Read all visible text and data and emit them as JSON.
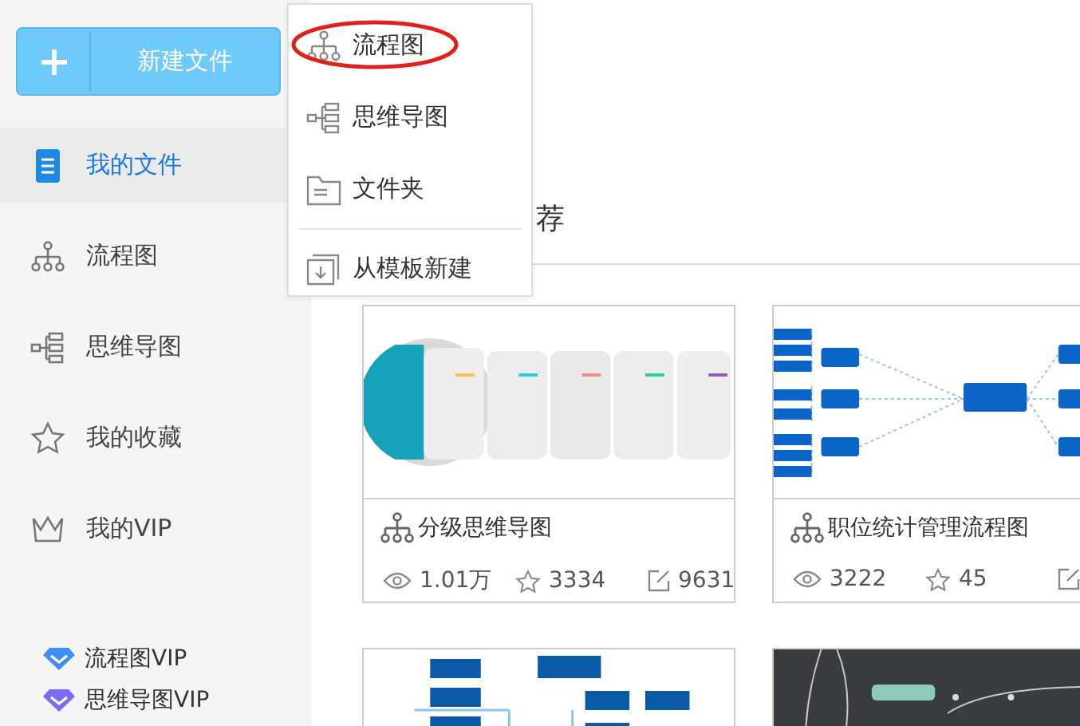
{
  "new_button": {
    "label": "新建文件"
  },
  "sidebar": {
    "items": [
      {
        "kind": "file",
        "label": "我的文件",
        "selected": true
      },
      {
        "kind": "flow",
        "label": "流程图",
        "selected": false
      },
      {
        "kind": "mind",
        "label": "思维导图",
        "selected": false
      },
      {
        "kind": "star",
        "label": "我的收藏",
        "selected": false
      },
      {
        "kind": "crown",
        "label": "我的VIP",
        "selected": false
      }
    ],
    "vip_links": [
      {
        "label": "流程图VIP",
        "color": "#3d8ff5"
      },
      {
        "label": "思维导图VIP",
        "color": "#7b6cf6"
      }
    ]
  },
  "heading": "荐",
  "dropdown": {
    "items": [
      {
        "kind": "flow",
        "label": "流程图",
        "circled": true
      },
      {
        "kind": "mind",
        "label": "思维导图",
        "circled": false
      },
      {
        "kind": "folder",
        "label": "文件夹",
        "circled": false
      },
      {
        "kind": "template",
        "label": "从模板新建",
        "circled": false,
        "divider_before": true
      }
    ]
  },
  "cards": [
    {
      "thumbnail": {
        "kind": "picture"
      },
      "title": "分级思维导图",
      "stats": [
        {
          "kind": "views",
          "value": "1.01万"
        },
        {
          "kind": "stars",
          "value": "3334"
        },
        {
          "kind": "edits",
          "value": "9631"
        }
      ]
    },
    {
      "thumbnail": {
        "kind": "picture"
      },
      "title": "职位统计管理流程图",
      "stats": [
        {
          "kind": "views",
          "value": "3222"
        },
        {
          "kind": "stars",
          "value": "45"
        },
        {
          "kind": "edits"
        }
      ]
    },
    {
      "thumbnail": {
        "kind": "picture"
      }
    },
    {
      "thumbnail": {
        "kind": "picture"
      }
    }
  ]
}
